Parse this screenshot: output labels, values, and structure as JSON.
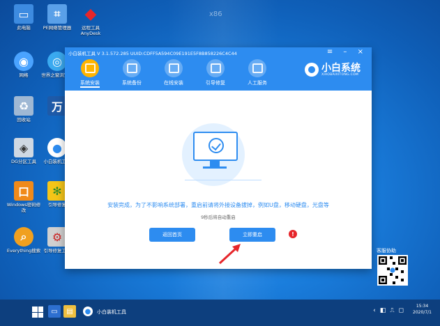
{
  "desktop": {
    "watermark": "x86",
    "icons_left": [
      {
        "label": "此电脑",
        "icon": "computer-icon",
        "color": "#3d8be0"
      },
      {
        "label": "网络",
        "icon": "network-icon",
        "color": "#4aa3ff"
      },
      {
        "label": "回收站",
        "icon": "recycle-bin-icon",
        "color": "#9fb8d4"
      },
      {
        "label": "DG分区工具",
        "icon": "disk-tool-icon",
        "color": "#cfd8e3"
      },
      {
        "label": "Windows密码修改",
        "icon": "password-tool-icon",
        "color": "#f08a1a"
      },
      {
        "label": "Everything搜索",
        "icon": "search-tool-icon",
        "color": "#f0a020"
      }
    ],
    "icons_right": [
      {
        "label": "PE网络管理器",
        "icon": "network-manager-icon",
        "color": "#5aa0e8"
      },
      {
        "label": "世界之窗浏览器",
        "icon": "browser-icon",
        "color": "#3aaaf0"
      },
      {
        "label": "万",
        "icon": "wan-icon",
        "color": "#1e5aa8"
      },
      {
        "label": "小白装机工具",
        "icon": "xiaobai-icon",
        "color": "#ffffff"
      },
      {
        "label": "引导修复",
        "icon": "boot-repair-icon",
        "color": "#f5c518"
      },
      {
        "label": "引导修复工具",
        "icon": "boot-fix-tool-icon",
        "color": "#d0d0d0"
      }
    ],
    "icons_extra": [
      {
        "label": "远程工具AnyDesk",
        "icon": "anydesk-icon",
        "color": "#e8262a"
      }
    ],
    "qr_label": "客服协助"
  },
  "window": {
    "title": "小白装机工具 V 3.1.572.285 UUID:CDFF5A594C09E191E5F8B858226C4C44",
    "controls": [
      "≡",
      "–",
      "×"
    ],
    "nav": [
      {
        "label": "系统安装",
        "active": true
      },
      {
        "label": "系统备份",
        "active": false
      },
      {
        "label": "在线安装",
        "active": false
      },
      {
        "label": "引导修复",
        "active": false
      },
      {
        "label": "人工服务",
        "active": false
      }
    ],
    "brand": {
      "name": "小白系统",
      "url": "XIAOBAIXITONG.COM"
    },
    "message": "安装完成，为了不影响系统部署，重启前请将外接设备拔掉，例如U盘，移动硬盘，光盘等",
    "submessage": "9秒后将自动重启",
    "buttons": {
      "back": "返回首页",
      "restart": "立即重启"
    },
    "badge": "!"
  },
  "taskbar": {
    "app_label": "小白装机工具",
    "clock_time": "15:34",
    "clock_date": "2020/7/1",
    "tray": [
      "‹",
      "◧",
      "⎍",
      "◻"
    ]
  }
}
